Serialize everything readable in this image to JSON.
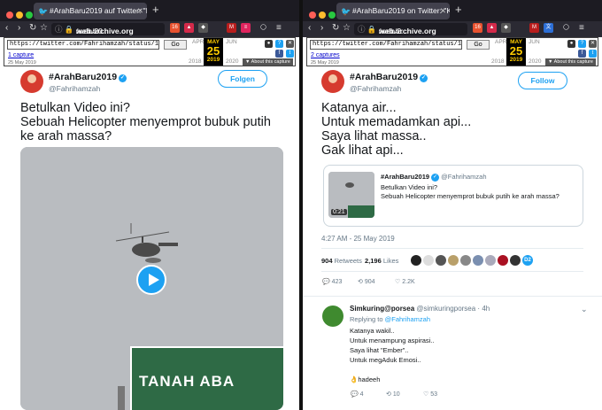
{
  "left": {
    "tab_title": "#ArahBaru2019 auf Twitter: \"Be",
    "url_domain": "web.archive.org",
    "url_path": "/web/20...",
    "wayback": {
      "url": "https://twitter.com/Fahrihamzah/status/11322462415",
      "go": "Go",
      "prev_month": "APR",
      "month": "MAY",
      "day": "25",
      "year": "2019",
      "next_month": "JUN",
      "prev_year": "2018",
      "next_year": "2020",
      "captures": "1 capture",
      "capture_date": "25 May 2019",
      "about": "▼ About this capture"
    },
    "tweet": {
      "name": "#ArahBaru2019",
      "handle": "@Fahrihamzah",
      "follow": "Folgen",
      "lines": [
        "Betulkan Video ini?",
        "Sebuah Helicopter menyemprot bubuk putih",
        "ke arah massa?"
      ],
      "sign_text": "TANAH ABA"
    }
  },
  "right": {
    "tab_title": "#ArahBaru2019 on Twitter: \"Kat",
    "url_domain": "web.archive.org",
    "url_path": "/web/2...",
    "wayback": {
      "url": "https://twitter.com/Fahrihamzah/status/11322467499",
      "go": "Go",
      "prev_month": "APR",
      "month": "MAY",
      "day": "25",
      "year": "2019",
      "next_month": "JUN",
      "prev_year": "2018",
      "next_year": "2020",
      "captures": "2 captures",
      "capture_date": "25 May 2019",
      "about": "▼ About this capture"
    },
    "tweet": {
      "name": "#ArahBaru2019",
      "handle": "@Fahrihamzah",
      "follow": "Follow",
      "lines": [
        "Katanya air...",
        "Untuk memadamkan api...",
        "Saya lihat massa..",
        "Gak lihat api..."
      ],
      "quote": {
        "name": "#ArahBaru2019",
        "handle": "@Fahrihamzah",
        "line1": "Betulkan Video ini?",
        "line2": "Sebuah Helicopter menyemprot bubuk putih ke arah massa?",
        "duration": "0:21",
        "sign_text": "TANAH ABA"
      },
      "timestamp": "4:27 AM - 25 May 2019",
      "retweets_count": "904",
      "retweets_label": "Retweets",
      "likes_count": "2,196",
      "likes_label": "Likes",
      "likers_more": "D2",
      "replies": "423",
      "rts": "904",
      "likes": "2.2K"
    },
    "reply": {
      "name": "Simkuring@porsea",
      "handle": "@simkuringporsea · 4h",
      "replying_prefix": "Replying to",
      "replying_to": "@Fahrihamzah",
      "lines": [
        "Katanya wakil..",
        "Untuk menampung aspirasi..",
        "Saya lihat \"Ember\"..",
        "Untuk megAduk Emosi..",
        "",
        "👌hadeeh"
      ],
      "replies": "4",
      "rts": "10",
      "likes": "53"
    }
  },
  "colors": {
    "twitter_blue": "#1da1f2",
    "tab_bar": "#1c1b22",
    "nav_bar": "#2b2a33",
    "sign_green": "#2e6a45"
  }
}
